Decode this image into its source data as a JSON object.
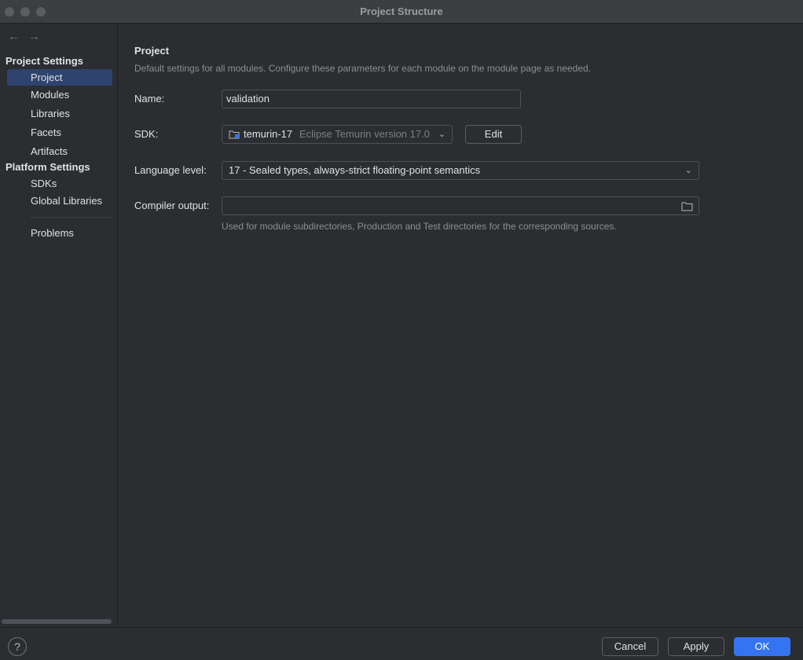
{
  "window": {
    "title": "Project Structure"
  },
  "sidebar": {
    "project_settings_title": "Project Settings",
    "project_items": [
      {
        "label": "Project",
        "selected": true
      },
      {
        "label": "Modules"
      },
      {
        "label": "Libraries"
      },
      {
        "label": "Facets"
      },
      {
        "label": "Artifacts"
      }
    ],
    "platform_settings_title": "Platform Settings",
    "platform_items": [
      {
        "label": "SDKs"
      },
      {
        "label": "Global Libraries"
      }
    ],
    "problems_label": "Problems"
  },
  "main": {
    "title": "Project",
    "description": "Default settings for all modules. Configure these parameters for each module on the module page as needed.",
    "name_label": "Name:",
    "name_value": "validation",
    "sdk_label": "SDK:",
    "sdk_name": "temurin-17",
    "sdk_version": "Eclipse Temurin version 17.0",
    "edit_label": "Edit",
    "language_level_label": "Language level:",
    "language_level_value": "17 - Sealed types, always-strict floating-point semantics",
    "compiler_output_label": "Compiler output:",
    "compiler_output_value": "",
    "compiler_output_hint": "Used for module subdirectories, Production and Test directories for the corresponding sources."
  },
  "footer": {
    "help_label": "?",
    "cancel_label": "Cancel",
    "apply_label": "Apply",
    "ok_label": "OK"
  },
  "colors": {
    "accent": "#3574f0",
    "selection": "#2e436e",
    "background": "#2b2d30"
  }
}
